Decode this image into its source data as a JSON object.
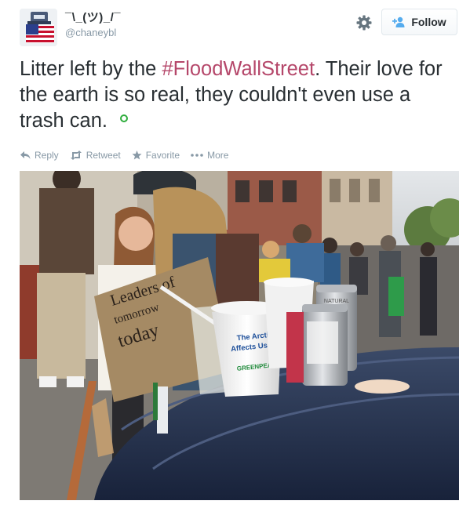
{
  "author": {
    "display_name": "¯\\_(ツ)_/¯",
    "screen_name": "@chaneybl",
    "avatar_icon": "flag-avatar"
  },
  "header": {
    "gear_icon": "gear-icon",
    "follow_label": "Follow"
  },
  "tweet": {
    "text_before": "Litter left by the ",
    "hashtag": "#FloodWallStreet",
    "text_after": ". Their love for the earth is so real, they couldn't even use a trash can.",
    "hashtag_color": "#b5476a"
  },
  "actions": {
    "reply": "Reply",
    "retweet": "Retweet",
    "favorite": "Favorite",
    "more": "More"
  },
  "photo": {
    "sign_text_1": "Leaders of",
    "sign_text_2": "tomorrow",
    "sign_text_3": "today",
    "cup_text_1": "The Arctic",
    "cup_text_2": "Affects Us All",
    "cup_brand": "GREENPEACE",
    "can_text": "NATURAL"
  }
}
